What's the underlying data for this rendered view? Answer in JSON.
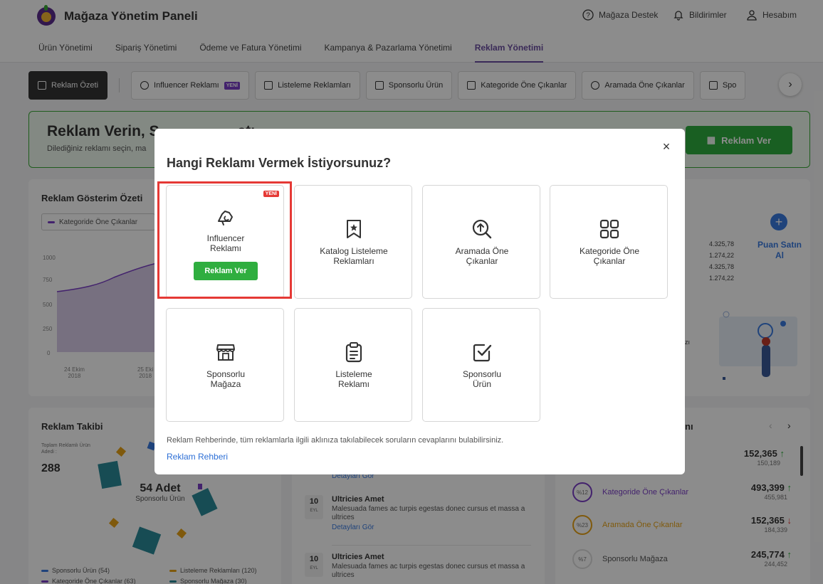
{
  "header": {
    "title": "Mağaza Yönetim Paneli",
    "support": "Mağaza Destek",
    "notifications": "Bildirimler",
    "account": "Hesabım"
  },
  "nav": {
    "tabs": [
      "Ürün Yönetimi",
      "Sipariş Yönetimi",
      "Ödeme ve Fatura Yönetimi",
      "Kampanya & Pazarlama Yönetimi",
      "Reklam Yönetimi"
    ],
    "active_index": 4
  },
  "subtabs": {
    "summary": "Reklam Özeti",
    "items": [
      "Influencer Reklamı",
      "Listeleme Reklamları",
      "Sponsorlu Ürün",
      "Kategoride Öne Çıkanlar",
      "Aramada Öne Çıkanlar",
      "Spo"
    ],
    "new_badge": "YENİ"
  },
  "banner": {
    "title": "Reklam Verin, S",
    "title_tail": "atı",
    "subtitle": "Dilediğiniz reklamı seçin, ma",
    "button": "Reklam Ver"
  },
  "impressions": {
    "title": "Reklam Gösterim Özeti",
    "legend": "Kategoride Öne Çıkanlar",
    "y_ticks": [
      "1000",
      "750",
      "500",
      "250",
      "0"
    ],
    "x_ticks": [
      "24 Ekim\n2018",
      "25 Eki\n2018"
    ],
    "stats": [
      "4.325,78",
      "1.274,22",
      "4.325,78",
      "1.274,22"
    ],
    "puan": "Puan Satın Al",
    "partial_label": "zı"
  },
  "tracking": {
    "title": "Reklam Takibi",
    "total_label": "Toplam Reklamlı Ürün Adedi :",
    "total_value": "288",
    "center_value": "54 Adet",
    "center_label": "Sponsorlu Ürün",
    "legend": [
      "Sponsorlu Ürün (54)",
      "Listeleme Reklamları (120)",
      "Kategoride Öne Çıkanlar (63)",
      "Sponsorlu Mağaza (30)"
    ]
  },
  "feed": {
    "top_link": "Detayları Gör",
    "items": [
      {
        "day": "10",
        "month": "EYL",
        "title": "Ultricies Amet",
        "desc": "Malesuada fames ac turpis egestas donec cursus et massa a ultrices",
        "link": "Detayları Gör"
      },
      {
        "day": "10",
        "month": "EYL",
        "title": "Ultricies Amet",
        "desc": "Malesuada fames ac turpis egestas donec cursus et massa a ultrices",
        "link": ""
      }
    ]
  },
  "ranking": {
    "title_tail": "nı",
    "rows": [
      {
        "pct": "",
        "label": "",
        "value": "152,365",
        "trend": "↑",
        "prev": "150,189",
        "color": "#2fae3f"
      },
      {
        "pct": "%12",
        "label": "Kategoride Öne Çıkanlar",
        "value": "493,399",
        "trend": "↑",
        "prev": "455,981",
        "color": "#7b3fc6"
      },
      {
        "pct": "%23",
        "label": "Aramada Öne Çıkanlar",
        "value": "152,365",
        "trend": "↓",
        "prev": "184,339",
        "color": "#e8a317"
      },
      {
        "pct": "%7",
        "label": "Sponsorlu Mağaza",
        "value": "245,774",
        "trend": "↑",
        "prev": "244,452",
        "color": "#666666"
      }
    ]
  },
  "modal": {
    "title": "Hangi Reklamı Vermek İstiyorsunuz?",
    "close": "×",
    "cards": [
      {
        "label": "Influencer\nReklamı",
        "icon": "influencer-icon",
        "badge": "YENİ",
        "button": "Reklam Ver"
      },
      {
        "label": "Katalog Listeleme\nReklamları",
        "icon": "bookmark-star-icon"
      },
      {
        "label": "Aramada Öne\nÇıkanlar",
        "icon": "search-up-icon"
      },
      {
        "label": "Kategoride Öne\nÇıkanlar",
        "icon": "grid-icon"
      },
      {
        "label": "Sponsorlu\nMağaza",
        "icon": "store-icon"
      },
      {
        "label": "Listeleme\nReklamı",
        "icon": "clipboard-icon"
      },
      {
        "label": "Sponsorlu\nÜrün",
        "icon": "checkbox-icon"
      }
    ],
    "footer": "Reklam Rehberinde, tüm reklamlarla ilgili aklınıza takılabilecek soruların cevaplarını bulabilirsiniz.",
    "link": "Reklam Rehberi"
  },
  "colors": {
    "accent": "#6b4ea0",
    "green": "#2fae3f",
    "highlight": "#e53935",
    "link": "#2d6fd6"
  }
}
